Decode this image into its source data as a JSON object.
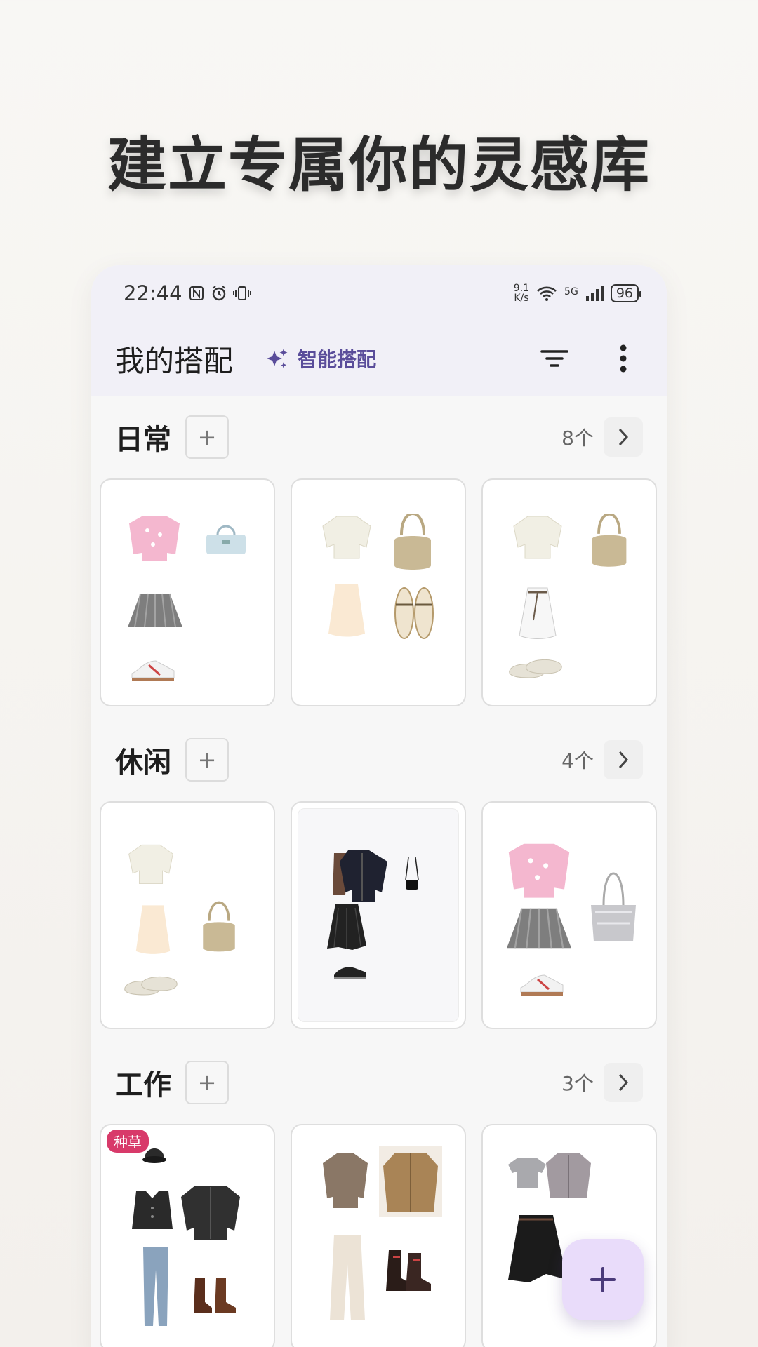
{
  "headline": "建立专属你的灵感库",
  "status": {
    "time": "22:44",
    "speed_top": "9.1",
    "speed_bottom": "K/s",
    "network": "5G",
    "battery": "96"
  },
  "appbar": {
    "title": "我的搭配",
    "smart_label": "智能搭配"
  },
  "sections": [
    {
      "title": "日常",
      "count": "8个"
    },
    {
      "title": "休闲",
      "count": "4个"
    },
    {
      "title": "工作",
      "count": "3个"
    }
  ],
  "badge": "种草",
  "colors": {
    "accent": "#5a4d9a",
    "fab_bg": "#e9dcfa",
    "badge_bg": "#d83a6a"
  }
}
